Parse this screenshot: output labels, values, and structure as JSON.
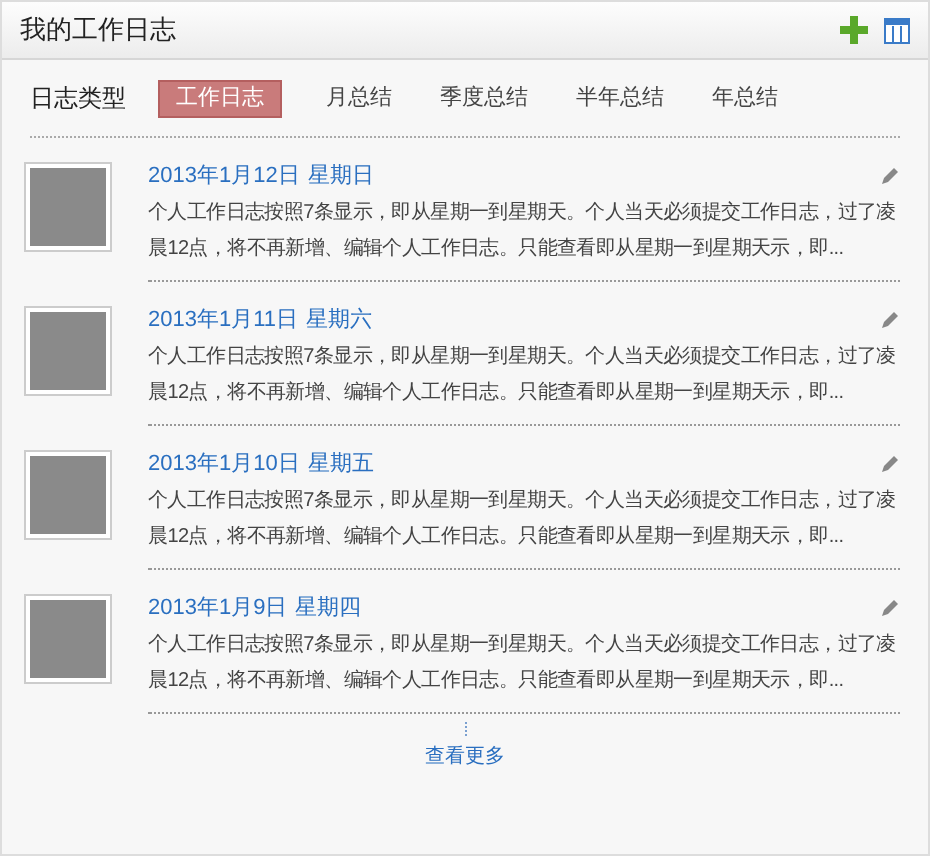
{
  "header": {
    "title": "我的工作日志"
  },
  "filter": {
    "label": "日志类型",
    "tabs": [
      {
        "label": "工作日志",
        "selected": true
      },
      {
        "label": "月总结",
        "selected": false
      },
      {
        "label": "季度总结",
        "selected": false
      },
      {
        "label": "半年总结",
        "selected": false
      },
      {
        "label": "年总结",
        "selected": false
      }
    ]
  },
  "entries": [
    {
      "date": "2013年1月12日",
      "weekday": "星期日",
      "text": "个人工作日志按照7条显示，即从星期一到星期天。个人当天必须提交工作日志，过了凌晨12点，将不再新增、编辑个人工作日志。只能查看即从星期一到星期天示，即..."
    },
    {
      "date": "2013年1月11日",
      "weekday": "星期六",
      "text": "个人工作日志按照7条显示，即从星期一到星期天。个人当天必须提交工作日志，过了凌晨12点，将不再新增、编辑个人工作日志。只能查看即从星期一到星期天示，即..."
    },
    {
      "date": "2013年1月10日",
      "weekday": "星期五",
      "text": "个人工作日志按照7条显示，即从星期一到星期天。个人当天必须提交工作日志，过了凌晨12点，将不再新增、编辑个人工作日志。只能查看即从星期一到星期天示，即..."
    },
    {
      "date": "2013年1月9日",
      "weekday": "星期四",
      "text": "个人工作日志按照7条显示，即从星期一到星期天。个人当天必须提交工作日志，过了凌晨12点，将不再新增、编辑个人工作日志。只能查看即从星期一到星期天示，即..."
    }
  ],
  "more_link": "查看更多"
}
